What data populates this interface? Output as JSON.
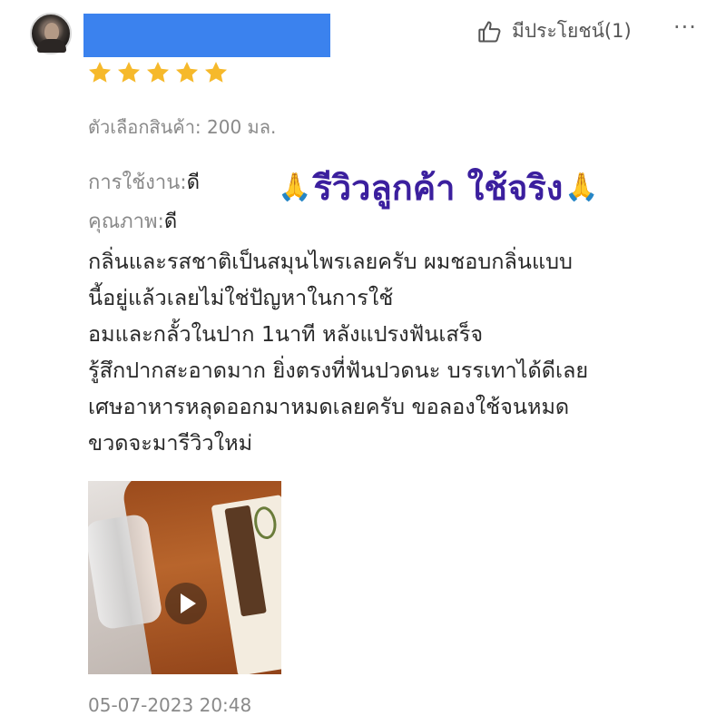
{
  "review": {
    "rating": 5,
    "rating_max": 5,
    "helpful_label": "มีประโยชน์(1)",
    "more_label": "···",
    "variant": "ตัวเลือกสินค้า: 200 มล.",
    "usage_label": "การใช้งาน:",
    "usage_value": "ดี",
    "quality_label": "คุณภาพ:",
    "quality_value": "ดี",
    "headline": "รีวิวลูกค้า ใช้จริง",
    "headline_emoji": "🙏",
    "body_lines": [
      "กลิ่นและรสชาติเป็นสมุนไพรเลยครับ ผมชอบกลิ่นแบบ",
      "นี้อยู่แล้วเลยไม่ใช่ปัญหาในการใช้",
      "อมและกลั้วในปาก 1นาที หลังแปรงฟันเสร็จ",
      "รู้สึกปากสะอาดมาก ยิ่งตรงที่ฟันปวดนะ บรรเทาได้ดีเลย",
      "เศษอาหารหลุดออกมาหมดเลยครับ ขอลองใช้จนหมด",
      "ขวดจะมารีวิวใหม่"
    ],
    "timestamp": "05-07-2023 20:48"
  },
  "colors": {
    "username_redaction": "#3b82ee",
    "star": "#f6b92b",
    "headline": "#3b1f9e"
  },
  "icons": {
    "avatar": "user-avatar",
    "star": "star-icon",
    "helpful": "thumbs-up-icon",
    "more": "more-options-icon",
    "play": "play-icon"
  }
}
